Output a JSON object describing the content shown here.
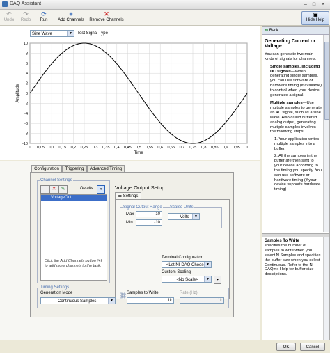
{
  "window": {
    "title": "DAQ Assistant",
    "close_glyph": "✕",
    "min_glyph": "–",
    "max_glyph": "□"
  },
  "toolbar": {
    "undo": "Undo",
    "redo": "Redo",
    "run": "Run",
    "add_channels": "Add Channels",
    "remove_channels": "Remove Channels",
    "hide_help": "Hide Help",
    "icons": {
      "undo": "undo-icon",
      "redo": "redo-icon",
      "run": "run-icon",
      "add": "add-icon",
      "remove": "remove-icon",
      "help": "help-icon"
    }
  },
  "signal": {
    "type_selected": "Sine Wave",
    "type_label": "Test Signal Type"
  },
  "chart_data": {
    "type": "line",
    "xlabel": "Time",
    "ylabel": "Amplitude",
    "xlim": [
      0,
      1
    ],
    "ylim": [
      -10,
      10
    ],
    "xticks": [
      "0",
      "0,05",
      "0,1",
      "0,15",
      "0,2",
      "0,25",
      "0,3",
      "0,35",
      "0,4",
      "0,45",
      "0,5",
      "0,55",
      "0,6",
      "0,65",
      "0,7",
      "0,75",
      "0,8",
      "0,85",
      "0,9",
      "0,95",
      "1"
    ],
    "yticks": [
      "-10",
      "-8",
      "-6",
      "-4",
      "-2",
      "0",
      "2",
      "4",
      "6",
      "8",
      "10"
    ],
    "series": [
      {
        "function": "10*sin(2*pi*x)",
        "color": "#000000"
      }
    ],
    "grid": true
  },
  "tabs": [
    "Configuration",
    "Triggering",
    "Advanced Timing"
  ],
  "channel_settings": {
    "label": "Channel Settings",
    "details": "Details",
    "channels": [
      "VoltageOut"
    ],
    "hint": "Click the Add Channels button (+) to add more channels to the task."
  },
  "voltage_setup": {
    "title": "Voltage Output Setup",
    "settings_tab": "Settings",
    "range_label": "Signal Output Range",
    "max_label": "Max",
    "max_value": "10",
    "min_label": "Min",
    "min_value": "-10",
    "units_label": "Scaled Units",
    "units_value": "Volts",
    "terminal_label": "Terminal Configuration",
    "terminal_value": "<Let NI-DAQ Choose>",
    "scaling_label": "Custom Scaling",
    "scaling_value": "<No Scale>"
  },
  "timing": {
    "label": "Timing Settings",
    "mode_label": "Generation Mode",
    "mode_value": "Continuous Samples",
    "samples_label": "Samples to Write",
    "samples_value": "1k",
    "rate_label": "Rate (Hz)",
    "rate_value": "1k"
  },
  "help": {
    "back": "Back",
    "title": "Generating Current or Voltage",
    "intro": "You can generate two main kinds of signals for channels:",
    "b1_title": "Single samples, including DC signals",
    "b1_text": "—When generating single samples, you can use software or hardware timing (if available) to control when your device generates a signal.",
    "b2_title": "Multiple samples",
    "b2_text": "—Use multiple samples to generate an AC signal, such as a sine wave. Also called buffered analog output, generating multiple samples involves the following steps:",
    "steps": [
      "1. Your application writes multiple samples into a buffer.",
      "2. All the samples in the buffer are then sent to your device according to the timing you specify. You can use software or hardware timing (if your device supports hardware timing)"
    ],
    "sec2_title": "Samples To Write",
    "sec2_text": "specifies the number of samples to write when you select N Samples and specifies the buffer size when you select Continuous. Refer to the NI-DAQmx Help for buffer size descriptions."
  },
  "footer": {
    "ok": "OK",
    "cancel": "Cancel"
  }
}
